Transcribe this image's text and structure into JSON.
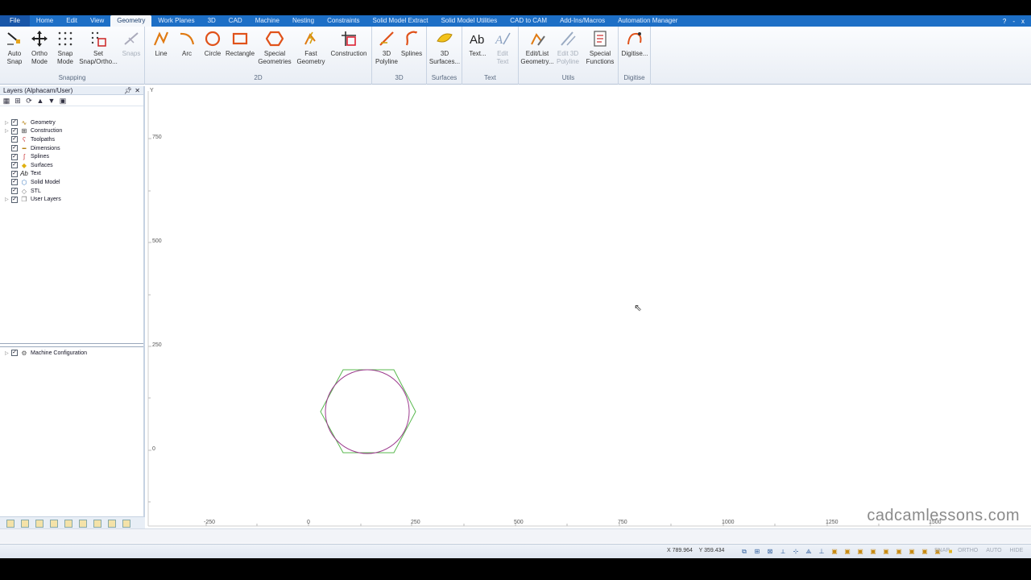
{
  "menu": {
    "tabs": [
      "File",
      "Home",
      "Edit",
      "View",
      "Geometry",
      "Work Planes",
      "3D",
      "CAD",
      "Machine",
      "Nesting",
      "Constraints",
      "Solid Model Extract",
      "Solid Model Utilities",
      "CAD to CAM",
      "Add-Ins/Macros",
      "Automation Manager"
    ],
    "active_tab": "Geometry",
    "window_controls": [
      "?",
      "-",
      "x"
    ]
  },
  "ribbon": {
    "groups": {
      "snapping": "Snapping",
      "twod": "2D",
      "threed": "3D",
      "surfaces": "Surfaces",
      "text": "Text",
      "utils": "Utils",
      "digitise": "Digitise"
    },
    "buttons": {
      "auto_snap": "Auto\nSnap",
      "ortho_mode": "Ortho\nMode",
      "snap_mode": "Snap\nMode",
      "set_snap": "Set\nSnap/Ortho...",
      "snaps": "Snaps",
      "line": "Line",
      "arc": "Arc",
      "circle": "Circle",
      "rectangle": "Rectangle",
      "special_geometries": "Special\nGeometries",
      "fast_geometry": "Fast\nGeometry",
      "construction": "Construction",
      "polyline_3d": "3D\nPolyline",
      "splines": "Splines",
      "surfaces_3d": "3D\nSurfaces...",
      "text": "Text...",
      "edit_text": "Edit\nText",
      "edit_list_geometry": "Edit/List\nGeometry...",
      "edit_3d_polyline": "Edit 3D\nPolyline",
      "special_functions": "Special\nFunctions",
      "digitise": "Digitise..."
    }
  },
  "layers_panel": {
    "title": "Layers (Alphacam/User)",
    "items": [
      "Geometry",
      "Construction",
      "Toolpaths",
      "Dimensions",
      "Splines",
      "Surfaces",
      "Text",
      "Solid Model",
      "STL",
      "User Layers"
    ],
    "machine_item": "Machine Configuration"
  },
  "canvas": {
    "y_axis_label": "Y",
    "y_ticks": [
      "750",
      "500",
      "250",
      "0"
    ],
    "x_ticks": [
      "-250",
      "0",
      "250",
      "500",
      "750",
      "1000",
      "1250",
      "1500"
    ],
    "colors": {
      "hexagon": "#59b84f",
      "circle": "#9c3c8e",
      "grid_tick": "#bbbbbb"
    },
    "watermark": "cadcamlessons.com"
  },
  "statusbar": {
    "x_coord": "X 789.964",
    "y_coord": "Y 359.434",
    "modes": [
      "SNAP",
      "ORTHO",
      "AUTO",
      "HIDE"
    ]
  }
}
